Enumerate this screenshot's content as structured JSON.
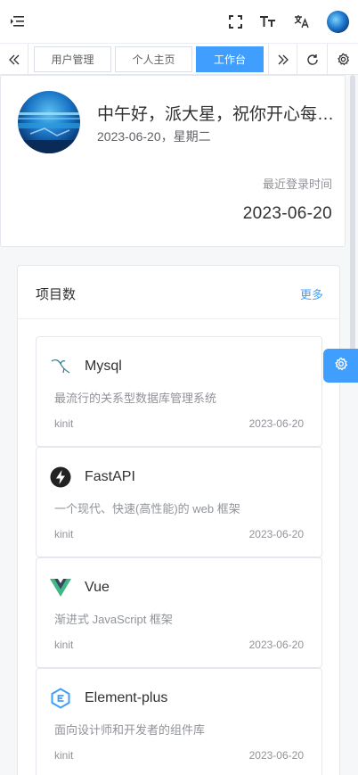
{
  "header": {
    "icons": [
      "menu-fold-icon",
      "fullscreen-icon",
      "font-size-icon",
      "translate-icon"
    ]
  },
  "tabs": {
    "items": [
      {
        "label": "用户管理",
        "active": false
      },
      {
        "label": "个人主页",
        "active": false
      },
      {
        "label": "工作台",
        "active": true
      }
    ]
  },
  "greeting": {
    "title": "中午好，派大星，祝你开心每一天！",
    "subtitle": "2023-06-20，星期二",
    "last_login_label": "最近登录时间",
    "last_login_value": "2023-06-20"
  },
  "projects": {
    "title": "项目数",
    "more": "更多",
    "items": [
      {
        "name": "Mysql",
        "desc": "最流行的关系型数据库管理系统",
        "tag": "kinit",
        "date": "2023-06-20",
        "icon": "mysql-icon"
      },
      {
        "name": "FastAPI",
        "desc": "一个现代、快速(高性能)的 web 框架",
        "tag": "kinit",
        "date": "2023-06-20",
        "icon": "fastapi-icon"
      },
      {
        "name": "Vue",
        "desc": "渐进式 JavaScript 框架",
        "tag": "kinit",
        "date": "2023-06-20",
        "icon": "vue-icon"
      },
      {
        "name": "Element-plus",
        "desc": "面向设计师和开发者的组件库",
        "tag": "kinit",
        "date": "2023-06-20",
        "icon": "element-plus-icon"
      }
    ]
  },
  "colors": {
    "accent": "#409eff"
  }
}
